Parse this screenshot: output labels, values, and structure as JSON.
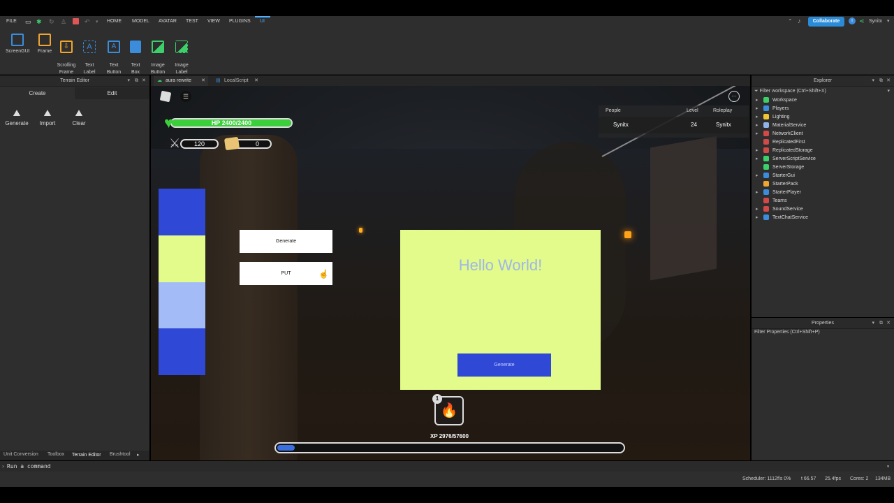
{
  "menu": [
    "FILE",
    "HOME",
    "MODEL",
    "AVATAR",
    "TEST",
    "VIEW",
    "PLUGINS",
    "UI"
  ],
  "collaborate": "Collaborate",
  "user": "Synitx",
  "ribbon_tools": [
    {
      "label": "ScreenGUI",
      "color": "#3b8ddc"
    },
    {
      "label": "Frame",
      "color": "#f0a531"
    },
    {
      "label": "Scrolling\nFrame",
      "color": "#f0a531"
    },
    {
      "label": "Text\nLabel",
      "color": "#3b8ddc"
    },
    {
      "label": "Text\nButton",
      "color": "#3b8ddc"
    },
    {
      "label": "Text\nBox",
      "color": "#3b8ddc"
    },
    {
      "label": "Image\nButton",
      "color": "#3ccf6a"
    },
    {
      "label": "Image\nLabel",
      "color": "#3ccf6a"
    }
  ],
  "terrain": {
    "title": "Terrain Editor",
    "tabs": [
      "Create",
      "Edit"
    ],
    "tools": [
      "Generate",
      "Import",
      "Clear"
    ]
  },
  "doc_tabs": [
    "aura rewrite",
    "LocalScript"
  ],
  "bottom_tabs": [
    "Unit Conversion",
    "Toolbox",
    "Terrain Editor",
    "Brushtool"
  ],
  "command": "Run a command",
  "status": {
    "scheduler": "Scheduler: 1112f/s 0%",
    "t": "t 66.57",
    "fps": "25.4fps",
    "cores": "Cores: 2",
    "mem": "134MB"
  },
  "hud": {
    "hp_text": "HP 2400/2400",
    "hp_fraction": 1.0,
    "swords": "120",
    "gold": "0",
    "xp_text": "XP 2976/57600",
    "xp_fraction": 0.05,
    "slot_badge": "1"
  },
  "leaderboard": {
    "headers": [
      "People",
      "Level",
      "Roleplay"
    ],
    "rows": [
      [
        "Synitx",
        "24",
        "Synitx"
      ]
    ]
  },
  "swatches": [
    "#2f48d6",
    "#e2fb8a",
    "#a3bcf8",
    "#2f48d6"
  ],
  "buttons": {
    "generate": "Generate",
    "put": "PUT"
  },
  "card": {
    "title": "Hello World!",
    "button": "Generate",
    "bg": "#e2fb8a",
    "button_bg": "#2f48d6"
  },
  "explorer": {
    "title": "Explorer",
    "filter": "Filter workspace (Ctrl+Shift+X)",
    "items": [
      {
        "label": "Workspace",
        "color": "#3ccf6a",
        "arrow": true
      },
      {
        "label": "Players",
        "color": "#3b8ddc",
        "arrow": true
      },
      {
        "label": "Lighting",
        "color": "#f0c531",
        "arrow": true
      },
      {
        "label": "MaterialService",
        "color": "#8fb4e8",
        "arrow": true
      },
      {
        "label": "NetworkClient",
        "color": "#d04a4a",
        "arrow": true
      },
      {
        "label": "ReplicatedFirst",
        "color": "#d04a4a",
        "arrow": false
      },
      {
        "label": "ReplicatedStorage",
        "color": "#d04a4a",
        "arrow": true
      },
      {
        "label": "ServerScriptService",
        "color": "#3ccf6a",
        "arrow": true
      },
      {
        "label": "ServerStorage",
        "color": "#3ccf6a",
        "arrow": false
      },
      {
        "label": "StarterGui",
        "color": "#3b8ddc",
        "arrow": true
      },
      {
        "label": "StarterPack",
        "color": "#f0a531",
        "arrow": false
      },
      {
        "label": "StarterPlayer",
        "color": "#3b8ddc",
        "arrow": true
      },
      {
        "label": "Teams",
        "color": "#d04a4a",
        "arrow": false
      },
      {
        "label": "SoundService",
        "color": "#d04a4a",
        "arrow": true
      },
      {
        "label": "TextChatService",
        "color": "#3b8ddc",
        "arrow": true
      }
    ]
  },
  "properties": {
    "title": "Properties",
    "filter": "Filter Properties (Ctrl+Shift+P)"
  }
}
